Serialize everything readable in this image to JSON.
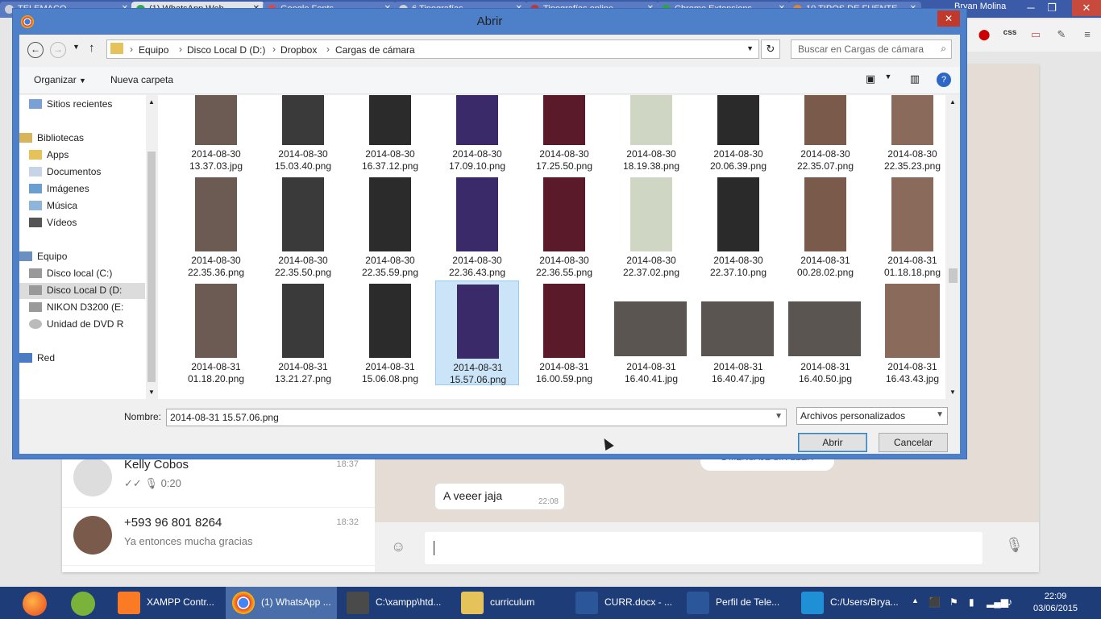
{
  "chrome": {
    "tabs": [
      "TELEMACO",
      "(1) WhatsApp Web",
      "Google Fonts",
      "6 Tipografías",
      "Tipografías online",
      "Chrome Extensions",
      "10 TIPOS DE FUENTE"
    ],
    "user": "Bryan Molina"
  },
  "whatsapp": {
    "chats": [
      {
        "name": "Kelly Cobos",
        "time": "18:37",
        "msg": "0:20"
      },
      {
        "name": "+593 96 801 8264",
        "time": "18:32",
        "msg": "Ya entonces mucha gracias"
      }
    ],
    "unread": "1 MENSAJE SIN LEER",
    "bubble": {
      "text": "A veeer jaja",
      "time": "22:08"
    }
  },
  "dialog": {
    "title": "Abrir",
    "breadcrumbs": [
      "Equipo",
      "Disco Local D (D:)",
      "Dropbox",
      "Cargas de cámara"
    ],
    "search_placeholder": "Buscar en Cargas de cámara",
    "toolbar": {
      "organize": "Organizar",
      "new_folder": "Nueva carpeta"
    },
    "nav": [
      {
        "label": "Sitios recientes",
        "icon": "recent-places-icon"
      },
      {
        "label": "Bibliotecas",
        "icon": "libraries-icon"
      },
      {
        "label": "Apps",
        "icon": "folder-icon"
      },
      {
        "label": "Documentos",
        "icon": "documents-icon"
      },
      {
        "label": "Imágenes",
        "icon": "pictures-icon"
      },
      {
        "label": "Música",
        "icon": "music-icon"
      },
      {
        "label": "Vídeos",
        "icon": "videos-icon"
      },
      {
        "label": "Equipo",
        "icon": "computer-icon"
      },
      {
        "label": "Disco local (C:)",
        "icon": "drive-icon"
      },
      {
        "label": "Disco Local D (D:",
        "icon": "drive-icon"
      },
      {
        "label": "NIKON D3200 (E:",
        "icon": "drive-icon"
      },
      {
        "label": "Unidad de DVD R",
        "icon": "dvd-icon"
      },
      {
        "label": "Red",
        "icon": "network-icon"
      }
    ],
    "files": [
      [
        "2014-08-30",
        "13.37.03.jpg"
      ],
      [
        "2014-08-30",
        "15.03.40.png"
      ],
      [
        "2014-08-30",
        "16.37.12.png"
      ],
      [
        "2014-08-30",
        "17.09.10.png"
      ],
      [
        "2014-08-30",
        "17.25.50.png"
      ],
      [
        "2014-08-30",
        "18.19.38.png"
      ],
      [
        "2014-08-30",
        "20.06.39.png"
      ],
      [
        "2014-08-30",
        "22.35.07.png"
      ],
      [
        "2014-08-30",
        "22.35.23.png"
      ],
      [
        "2014-08-30",
        "22.35.36.png"
      ],
      [
        "2014-08-30",
        "22.35.50.png"
      ],
      [
        "2014-08-30",
        "22.35.59.png"
      ],
      [
        "2014-08-30",
        "22.36.43.png"
      ],
      [
        "2014-08-30",
        "22.36.55.png"
      ],
      [
        "2014-08-30",
        "22.37.02.png"
      ],
      [
        "2014-08-30",
        "22.37.10.png"
      ],
      [
        "2014-08-31",
        "00.28.02.png"
      ],
      [
        "2014-08-31",
        "01.18.18.png"
      ],
      [
        "2014-08-31",
        "01.18.20.png"
      ],
      [
        "2014-08-31",
        "13.21.27.png"
      ],
      [
        "2014-08-31",
        "15.06.08.png"
      ],
      [
        "2014-08-31",
        "15.57.06.png"
      ],
      [
        "2014-08-31",
        "16.00.59.png"
      ],
      [
        "2014-08-31",
        "16.40.41.jpg"
      ],
      [
        "2014-08-31",
        "16.40.47.jpg"
      ],
      [
        "2014-08-31",
        "16.40.50.jpg"
      ],
      [
        "2014-08-31",
        "16.43.43.jpg"
      ]
    ],
    "name_label": "Nombre:",
    "name_value": "2014-08-31 15.57.06.png",
    "file_type": "Archivos personalizados",
    "open_button": "Abrir",
    "cancel_button": "Cancelar"
  },
  "taskbar": {
    "apps": [
      "XAMPP Contr...",
      "(1) WhatsApp ...",
      "C:\\xampp\\htd...",
      "curriculum",
      "CURR.docx - ...",
      "Perfil de Tele...",
      "C:/Users/Brya..."
    ],
    "time": "22:09",
    "date": "03/06/2015"
  }
}
